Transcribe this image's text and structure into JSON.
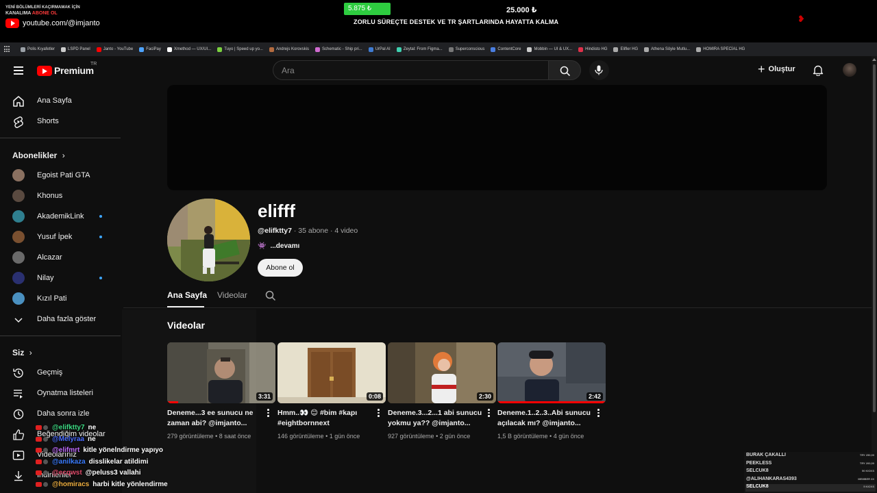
{
  "overlay": {
    "promo_line1": "YENİ BÖLÜMLERİ KAÇIRMAMAK İÇİN",
    "promo_line2_a": "KANALIMA",
    "promo_line2_b": "ABONE OL",
    "promo_url": "youtube.com/@imjanto",
    "goal_current": "5.875 ₺",
    "goal_target": "25.000 ₺",
    "goal_text": "ZORLU SÜREÇTE DESTEK VE TR ŞARTLARINDA HAYATTA KALMA",
    "goal_progress": 0.235
  },
  "bookmarks": [
    {
      "label": "Polis Kıyafetler",
      "color": "#9aa0a6"
    },
    {
      "label": "LSPD Panel",
      "color": "#cccccc"
    },
    {
      "label": "Janto - YouTube",
      "color": "#ff0000"
    },
    {
      "label": "FaciPay",
      "color": "#4da3ff"
    },
    {
      "label": "Xmethod — UX/UI...",
      "color": "#ffffff"
    },
    {
      "label": "Tuyo | Speed up yo...",
      "color": "#7bd13f"
    },
    {
      "label": "Andrejs Korovskis",
      "color": "#b36b3f"
    },
    {
      "label": "Schematic - Ship pri...",
      "color": "#d06bd0"
    },
    {
      "label": "UrPal AI",
      "color": "#3f7bd1"
    },
    {
      "label": "Zeytal: From Figma...",
      "color": "#3fd1b0"
    },
    {
      "label": "Superconscious",
      "color": "#777777"
    },
    {
      "label": "ContentCore",
      "color": "#4a7ee0"
    },
    {
      "label": "Mobbin — UI & UX...",
      "color": "#cccccc"
    },
    {
      "label": "Hindisto HG",
      "color": "#e0304a"
    },
    {
      "label": "Elifler HG",
      "color": "#aaaaaa"
    },
    {
      "label": "Athena Söyle Mutlu...",
      "color": "#aaaaaa"
    },
    {
      "label": "HOMIRA SPECİAL HG",
      "color": "#aaaaaa"
    }
  ],
  "header": {
    "logo_text": "Premium",
    "logo_region": "TR",
    "search_placeholder": "Ara",
    "create_label": "Oluştur"
  },
  "sidebar": {
    "main": [
      {
        "label": "Ana Sayfa",
        "icon": "home-icon"
      },
      {
        "label": "Shorts",
        "icon": "shorts-icon"
      }
    ],
    "subscriptions_title": "Abonelikler",
    "subscriptions": [
      {
        "label": "Egoist Pati GTA",
        "color": "#8a7060",
        "dot": false
      },
      {
        "label": "Khonus",
        "color": "#5a4a40",
        "dot": false
      },
      {
        "label": "AkademikLink",
        "color": "#2f7f8f",
        "dot": true
      },
      {
        "label": "Yusuf İpek",
        "color": "#7a5030",
        "dot": true
      },
      {
        "label": "Alcazar",
        "color": "#6a6a6a",
        "dot": false
      },
      {
        "label": "Nilay",
        "color": "#2a3070",
        "dot": true
      },
      {
        "label": "Kızıl Pati",
        "color": "#4a90c0",
        "dot": false
      }
    ],
    "show_more": "Daha fazla göster",
    "you_title": "Siz",
    "you": [
      {
        "label": "Geçmiş",
        "icon": "history-icon"
      },
      {
        "label": "Oynatma listeleri",
        "icon": "playlists-icon"
      },
      {
        "label": "Daha sonra izle",
        "icon": "watch-later-icon"
      },
      {
        "label": "Beğendiğim videolar",
        "icon": "like-icon"
      },
      {
        "label": "Videolarınız",
        "icon": "your-videos-icon"
      },
      {
        "label": "İndirilenler",
        "icon": "download-icon"
      }
    ]
  },
  "channel": {
    "name": "elifff",
    "handle": "@elifktty7",
    "stats": " · 35 abone · 4 video",
    "desc_more": "...devamı",
    "subscribe_label": "Abone ol",
    "tabs": [
      "Ana Sayfa",
      "Videolar"
    ],
    "videos_section": "Videolar"
  },
  "videos": [
    {
      "title": "Deneme...3 ee sunucu ne zaman abi? @imjanto...",
      "views": "279 görüntüleme",
      "age": "8 saat önce",
      "duration": "3:31",
      "progress": 0.1
    },
    {
      "title": "Hmm..👀 😊 #bim #kapı #eightbornnext",
      "views": "146 görüntüleme",
      "age": "1 gün önce",
      "duration": "0:08",
      "progress": 0
    },
    {
      "title": "Deneme.3...2...1 abi sunucu yokmu ya?? @imjanto...",
      "views": "927 görüntüleme",
      "age": "2 gün önce",
      "duration": "2:30",
      "progress": 0
    },
    {
      "title": "Deneme.1..2..3..Abi sunucu açılacak mı? @imjanto...",
      "views": "1,5 B görüntüleme",
      "age": "4 gün önce",
      "duration": "2:42",
      "progress": 1.0
    }
  ],
  "chat": [
    {
      "user": "@elifktty7",
      "color": "#3ddc84",
      "msg": "ne"
    },
    {
      "user": "@Melyraa",
      "color": "#4a6cff",
      "msg": "ne"
    },
    {
      "user": "@elifmrt",
      "color": "#c06cff",
      "msg": "kitle yönelndirme yapıyo"
    },
    {
      "user": "@anilkaza",
      "color": "#3a7cff",
      "msg": "disslikelar atildimi"
    },
    {
      "user": "@ecqwst",
      "color": "#e04a6a",
      "msg": "@peluss3 vallahi"
    },
    {
      "user": "@homiracs",
      "color": "#f0b040",
      "msg": "harbi kitle yönlendirme"
    }
  ],
  "leaderboard": [
    {
      "name": "BURAK ÇAKALLI",
      "amount": "TRY 250,00"
    },
    {
      "name": "PEEKLESS",
      "amount": "TRY 200,00"
    },
    {
      "name": "SELCUK8",
      "amount": "50 KICKS"
    },
    {
      "name": "@ALIHANKARAS4393",
      "amount": "MEMBER 3X"
    },
    {
      "name": "SELCUK8",
      "amount": "5 KICKS"
    }
  ]
}
